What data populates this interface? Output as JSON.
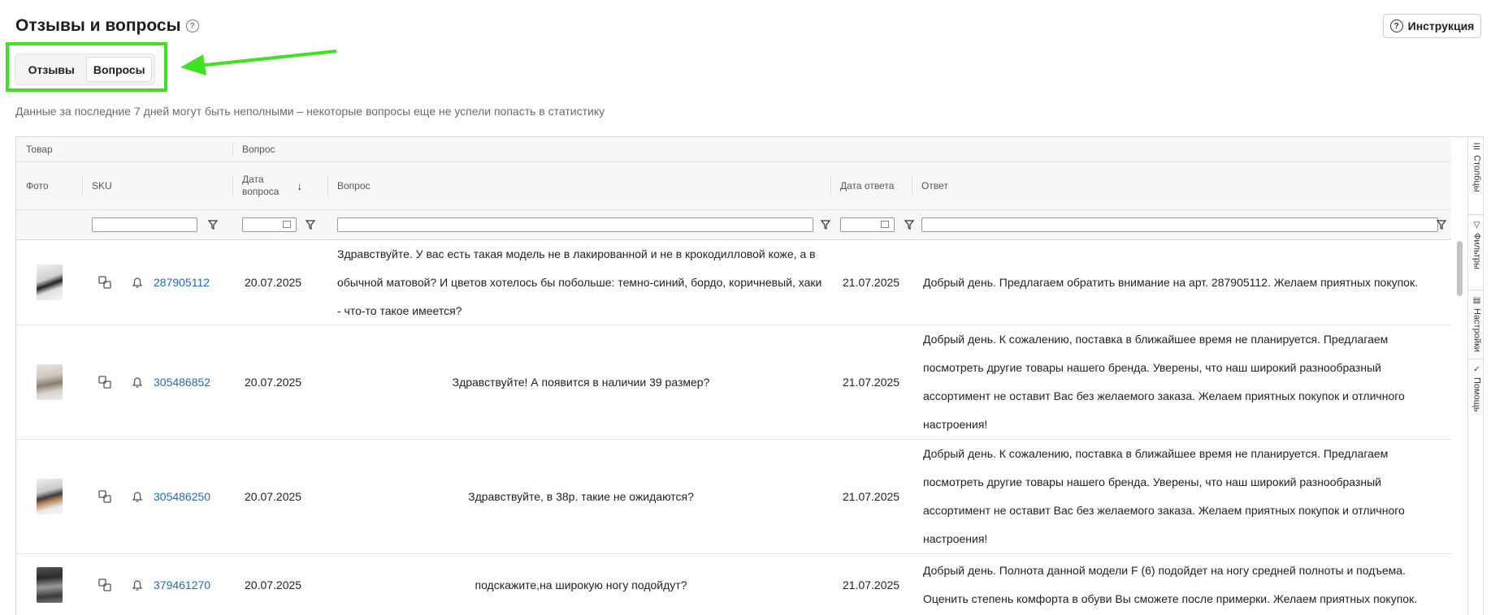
{
  "page": {
    "title": "Отзывы и вопросы",
    "instruction_label": "Инструкция",
    "notice": "Данные за последние 7 дней могут быть неполными – некоторые вопросы еще не успели попасть в статистику"
  },
  "tabs": [
    {
      "label": "Отзывы",
      "active": false
    },
    {
      "label": "Вопросы",
      "active": true
    }
  ],
  "annotation": {
    "highlight_color": "#3fe21e"
  },
  "table": {
    "groups": {
      "product": "Товар",
      "question": "Вопрос"
    },
    "columns": {
      "photo": "Фото",
      "sku": "SKU",
      "question_date": "Дата вопроса",
      "question": "Вопрос",
      "answer_date": "Дата ответа",
      "answer": "Ответ"
    },
    "rows": [
      {
        "sku": "287905112",
        "question_date": "20.07.2025",
        "question_lines": [
          "Здравствуйте. У вас есть такая модель не в лакированной и не в крокодилловой коже, а в",
          "обычной матовой? И цветов хотелось бы побольше: темно-синий, бордо, коричневый, хаки",
          "- что-то такое имеется?"
        ],
        "answer_date": "21.07.2025",
        "answer_lines": [
          "Добрый день. Предлагаем обратить внимание на арт. 287905112. Желаем приятных покупок."
        ]
      },
      {
        "sku": "305486852",
        "question_date": "20.07.2025",
        "question_lines": [
          "Здравствуйте! А появится в наличии 39 размер?"
        ],
        "answer_date": "21.07.2025",
        "answer_lines": [
          "Добрый день. К сожалению, поставка в ближайшее время не планируется. Предлагаем",
          "посмотреть другие товары нашего бренда. Уверены, что наш широкий разнообразный",
          "ассортимент не оставит Вас без желаемого заказа. Желаем приятных покупок и отличного",
          "настроения!"
        ]
      },
      {
        "sku": "305486250",
        "question_date": "20.07.2025",
        "question_lines": [
          "Здравствуйте, в 38р. такие не ожидаются?"
        ],
        "answer_date": "21.07.2025",
        "answer_lines": [
          "Добрый день. К сожалению, поставка в ближайшее время не планируется. Предлагаем",
          "посмотреть другие товары нашего бренда. Уверены, что наш широкий разнообразный",
          "ассортимент не оставит Вас без желаемого заказа. Желаем приятных покупок и отличного",
          "настроения!"
        ]
      },
      {
        "sku": "379461270",
        "question_date": "20.07.2025",
        "question_lines": [
          "подскажите,на широкую ногу подойдут?"
        ],
        "answer_date": "21.07.2025",
        "answer_lines": [
          "Добрый день. Полнота данной модели F (6) подойдет на ногу средней полноты и подъема.",
          "Оценить степень комфорта в обуви Вы сможете после примерки. Желаем приятных покупок."
        ]
      }
    ]
  },
  "side_panel": [
    "Столбцы",
    "Фильтры",
    "Настройки",
    "Помощь"
  ]
}
